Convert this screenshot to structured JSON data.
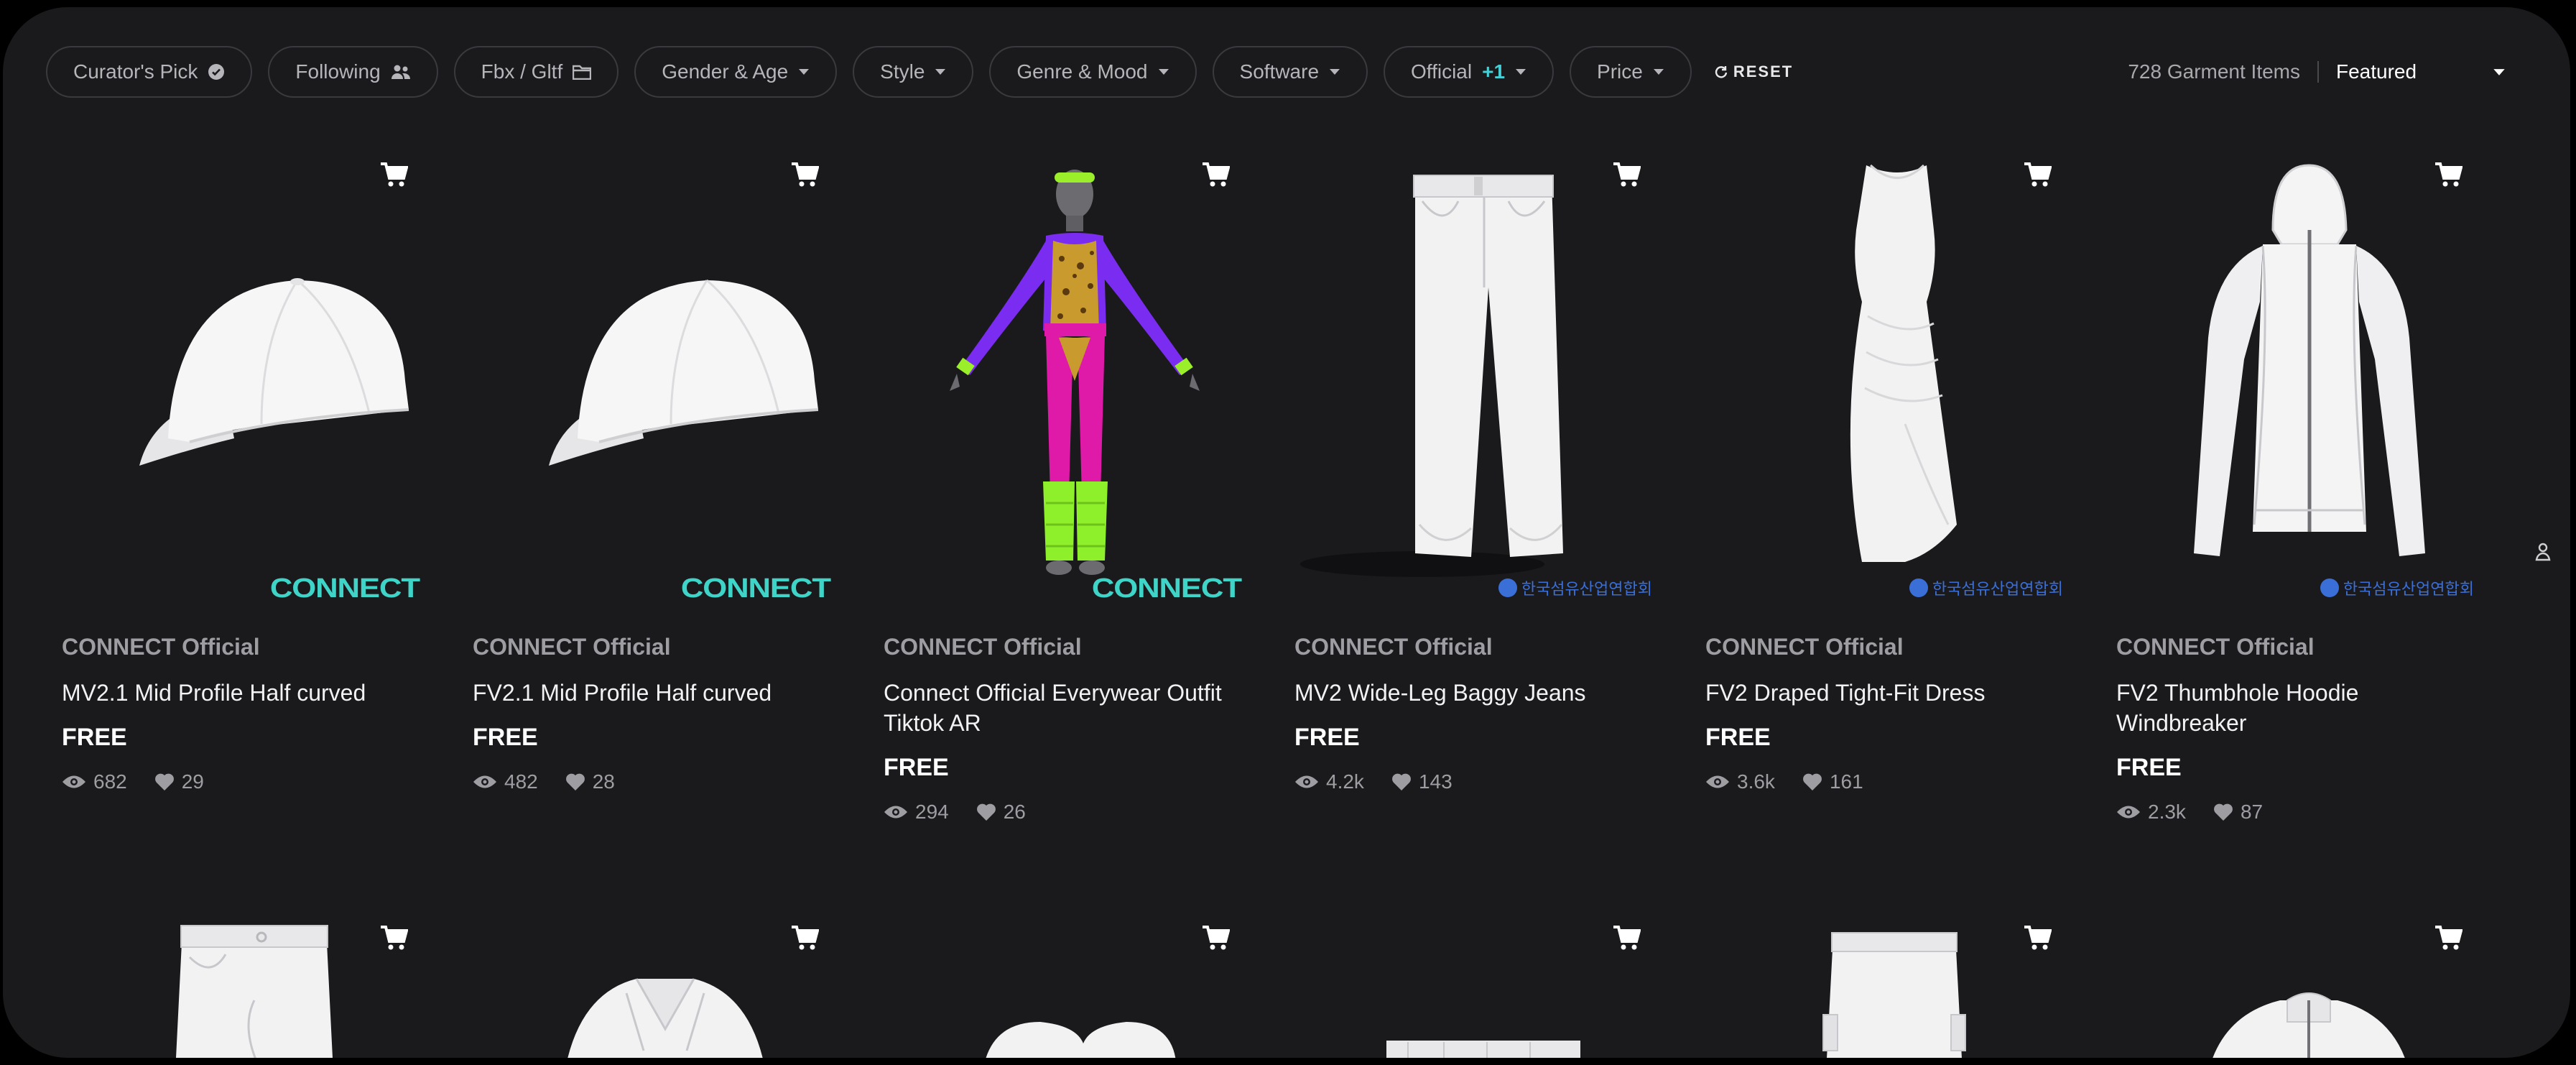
{
  "filters": {
    "curators_pick": "Curator's Pick",
    "following": "Following",
    "format": "Fbx / Gltf",
    "gender_age": "Gender & Age",
    "style": "Style",
    "genre_mood": "Genre & Mood",
    "software": "Software",
    "official": "Official",
    "official_badge": "+1",
    "price": "Price",
    "reset": "RESET"
  },
  "summary": {
    "count": "728 Garment Items",
    "sort": "Featured"
  },
  "items": [
    {
      "author": "CONNECT Official",
      "title": "MV2.1 Mid Profile Half curved",
      "price": "FREE",
      "views": "682",
      "likes": "29",
      "logo": "CONNECT"
    },
    {
      "author": "CONNECT Official",
      "title": "FV2.1 Mid Profile Half curved",
      "price": "FREE",
      "views": "482",
      "likes": "28",
      "logo": "CONNECT"
    },
    {
      "author": "CONNECT Official",
      "title": "Connect Official Everywear Outfit Tiktok AR",
      "price": "FREE",
      "views": "294",
      "likes": "26",
      "logo": "CONNECT"
    },
    {
      "author": "CONNECT Official",
      "title": "MV2 Wide-Leg Baggy Jeans",
      "price": "FREE",
      "views": "4.2k",
      "likes": "143",
      "logo": "한국섬유산업연합회"
    },
    {
      "author": "CONNECT Official",
      "title": "FV2 Draped Tight-Fit Dress",
      "price": "FREE",
      "views": "3.6k",
      "likes": "161",
      "logo": "한국섬유산업연합회"
    },
    {
      "author": "CONNECT Official",
      "title": "FV2 Thumbhole Hoodie Windbreaker",
      "price": "FREE",
      "views": "2.3k",
      "likes": "87",
      "logo": "한국섬유산업연합회"
    }
  ],
  "icons": {
    "cart": "cart-icon",
    "eye": "eye-icon",
    "heart": "heart-icon",
    "verified": "verified-icon",
    "people": "people-icon",
    "folder": "folder-icon",
    "chevron": "chevron-down-icon",
    "reset": "reset-icon",
    "side": "person-pin-icon"
  },
  "colors": {
    "background": "#1a1a1d",
    "accent": "#44d0d6",
    "connect_logo": "#3fd4c8",
    "kr_logo": "#3b6fd8"
  }
}
